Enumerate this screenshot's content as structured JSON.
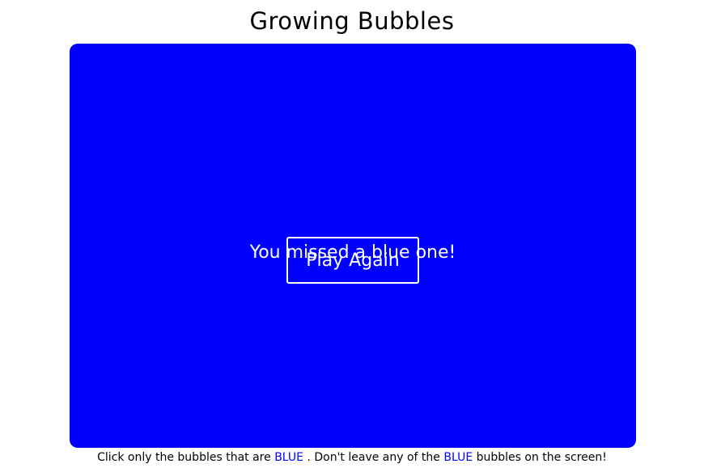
{
  "title": "Growing Bubbles",
  "board": {
    "background_color": "#0000ff",
    "message": "You missed a blue one!",
    "button_label": "Play Again",
    "text_color": "#ffffff"
  },
  "instructions": {
    "part1": "Click only the bubbles that are",
    "keyword1": "BLUE",
    "part2": ". Don't leave any of the",
    "keyword2": "BLUE",
    "part3": "bubbles on the screen!",
    "keyword_color": "#0000ff"
  }
}
